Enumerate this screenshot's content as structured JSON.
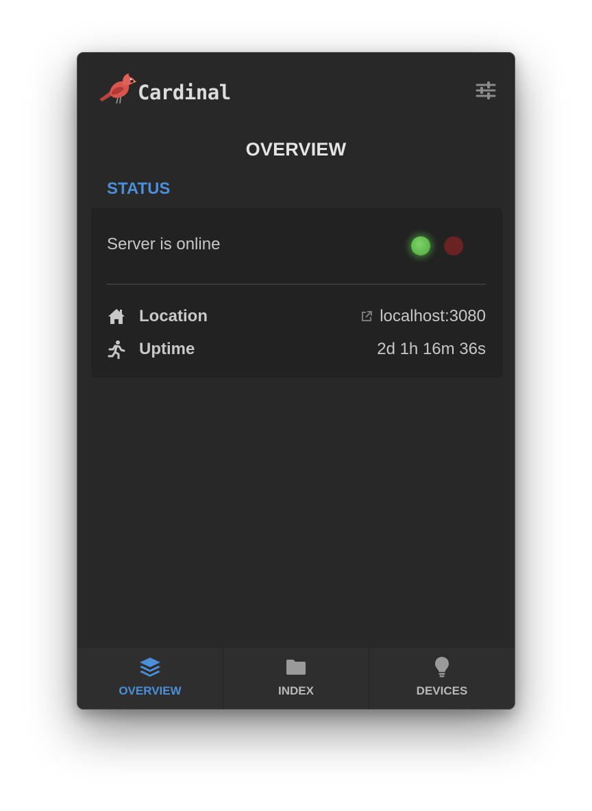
{
  "app": {
    "name": "Cardinal",
    "logo_icon": "cardinal-bird-icon",
    "settings_icon": "sliders-icon"
  },
  "page": {
    "title": "OVERVIEW"
  },
  "status": {
    "section_label": "STATUS",
    "message": "Server is online",
    "indicators": [
      {
        "name": "online",
        "state": "on",
        "color": "#5bb548"
      },
      {
        "name": "offline",
        "state": "off",
        "color": "#6b2222"
      }
    ]
  },
  "info": {
    "location": {
      "icon": "home-icon",
      "label": "Location",
      "link_icon": "external-link-icon",
      "value": "localhost:3080"
    },
    "uptime": {
      "icon": "running-icon",
      "label": "Uptime",
      "value": "2d 1h 16m 36s"
    }
  },
  "nav": {
    "items": [
      {
        "label": "OVERVIEW",
        "icon": "layers-icon",
        "active": true
      },
      {
        "label": "INDEX",
        "icon": "folder-icon",
        "active": false
      },
      {
        "label": "DEVICES",
        "icon": "lightbulb-icon",
        "active": false
      }
    ]
  },
  "colors": {
    "accent": "#4a8fd8",
    "background": "#282828",
    "card": "#222222"
  }
}
